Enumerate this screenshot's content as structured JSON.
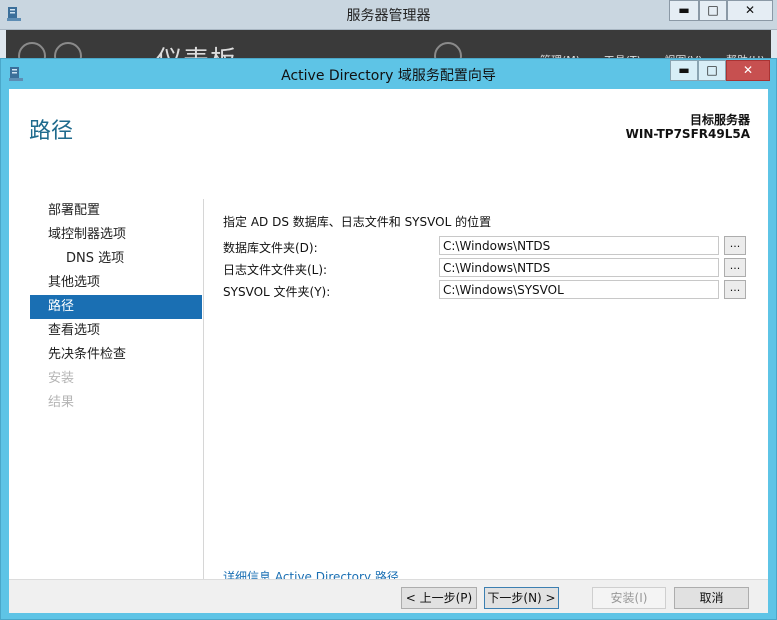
{
  "background_window": {
    "title": "服务器管理器",
    "header_title": "仪表板",
    "menu": "管理(M) 工具(T) 视图(V) 帮助(H)",
    "controls": {
      "minimize": "▬",
      "maximize": "□",
      "close": "✕"
    }
  },
  "dialog": {
    "title": "Active Directory 域服务配置向导",
    "controls": {
      "minimize": "▬",
      "maximize": "□",
      "close": "✕"
    },
    "page_heading": "路径",
    "target_server": {
      "label": "目标服务器",
      "name": "WIN-TP7SFR49L5A"
    },
    "nav": [
      {
        "label": "部署配置",
        "state": "normal",
        "indent": false
      },
      {
        "label": "域控制器选项",
        "state": "normal",
        "indent": false
      },
      {
        "label": "DNS 选项",
        "state": "normal",
        "indent": true
      },
      {
        "label": "其他选项",
        "state": "normal",
        "indent": false
      },
      {
        "label": "路径",
        "state": "active",
        "indent": false
      },
      {
        "label": "查看选项",
        "state": "normal",
        "indent": false
      },
      {
        "label": "先决条件检查",
        "state": "normal",
        "indent": false
      },
      {
        "label": "安装",
        "state": "disabled",
        "indent": false
      },
      {
        "label": "结果",
        "state": "disabled",
        "indent": false
      }
    ],
    "instruction": "指定 AD DS 数据库、日志文件和 SYSVOL 的位置",
    "paths": [
      {
        "label": "数据库文件夹(D):",
        "value": "C:\\Windows\\NTDS",
        "browse": "..."
      },
      {
        "label": "日志文件文件夹(L):",
        "value": "C:\\Windows\\NTDS",
        "browse": "..."
      },
      {
        "label": "SYSVOL 文件夹(Y):",
        "value": "C:\\Windows\\SYSVOL",
        "browse": "..."
      }
    ],
    "more_info_link": "详细信息 Active Directory 路径",
    "buttons": {
      "previous": "< 上一步(P)",
      "next": "下一步(N) >",
      "install": "安装(I)",
      "cancel": "取消"
    }
  }
}
